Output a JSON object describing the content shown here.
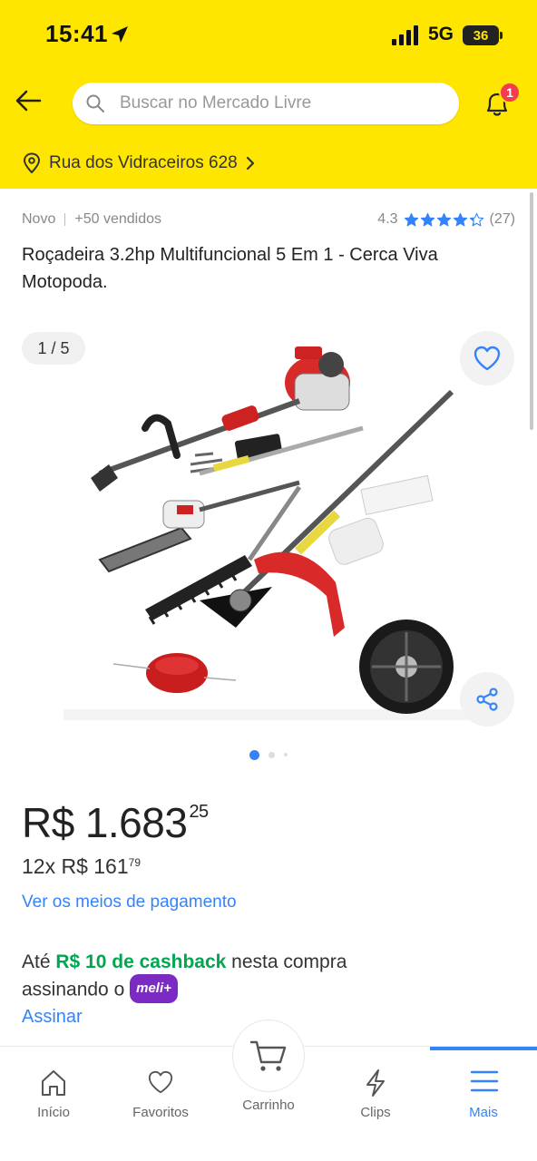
{
  "status_bar": {
    "time": "15:41",
    "network": "5G",
    "battery": "36"
  },
  "header": {
    "search_placeholder": "Buscar no Mercado Livre",
    "notification_count": "1",
    "address": "Rua dos Vidraceiros 628"
  },
  "product": {
    "condition": "Novo",
    "sold": "+50 vendidos",
    "rating": "4.3",
    "rating_stars": 4.3,
    "reviews": "(27)",
    "title": "Roçadeira 3.2hp Multifuncional 5 Em 1 - Cerca Viva Motopoda.",
    "image_counter": "1 / 5",
    "price_currency": "R$",
    "price_int": "1.683",
    "price_cents": "25",
    "installments_prefix": "12x R$",
    "installment_int": "161",
    "installment_cents": "79",
    "payment_link": "Ver os meios de pagamento",
    "cashback_prefix": "Até",
    "cashback_amount": "R$ 10 de cashback",
    "cashback_mid": "nesta compra",
    "cashback_line2": "assinando o",
    "meli_plus": "meli+",
    "subscribe": "Assinar"
  },
  "colors": {
    "brand_yellow": "#ffe600",
    "link_blue": "#3483fa",
    "cashback_green": "#00a650",
    "meli_plus_purple": "#7b2bc1"
  },
  "bottom_nav": {
    "items": [
      {
        "label": "Início",
        "icon": "home-icon"
      },
      {
        "label": "Favoritos",
        "icon": "heart-icon"
      },
      {
        "label": "Carrinho",
        "icon": "cart-icon"
      },
      {
        "label": "Clips",
        "icon": "clips-icon"
      },
      {
        "label": "Mais",
        "icon": "menu-icon",
        "active": true
      }
    ]
  }
}
